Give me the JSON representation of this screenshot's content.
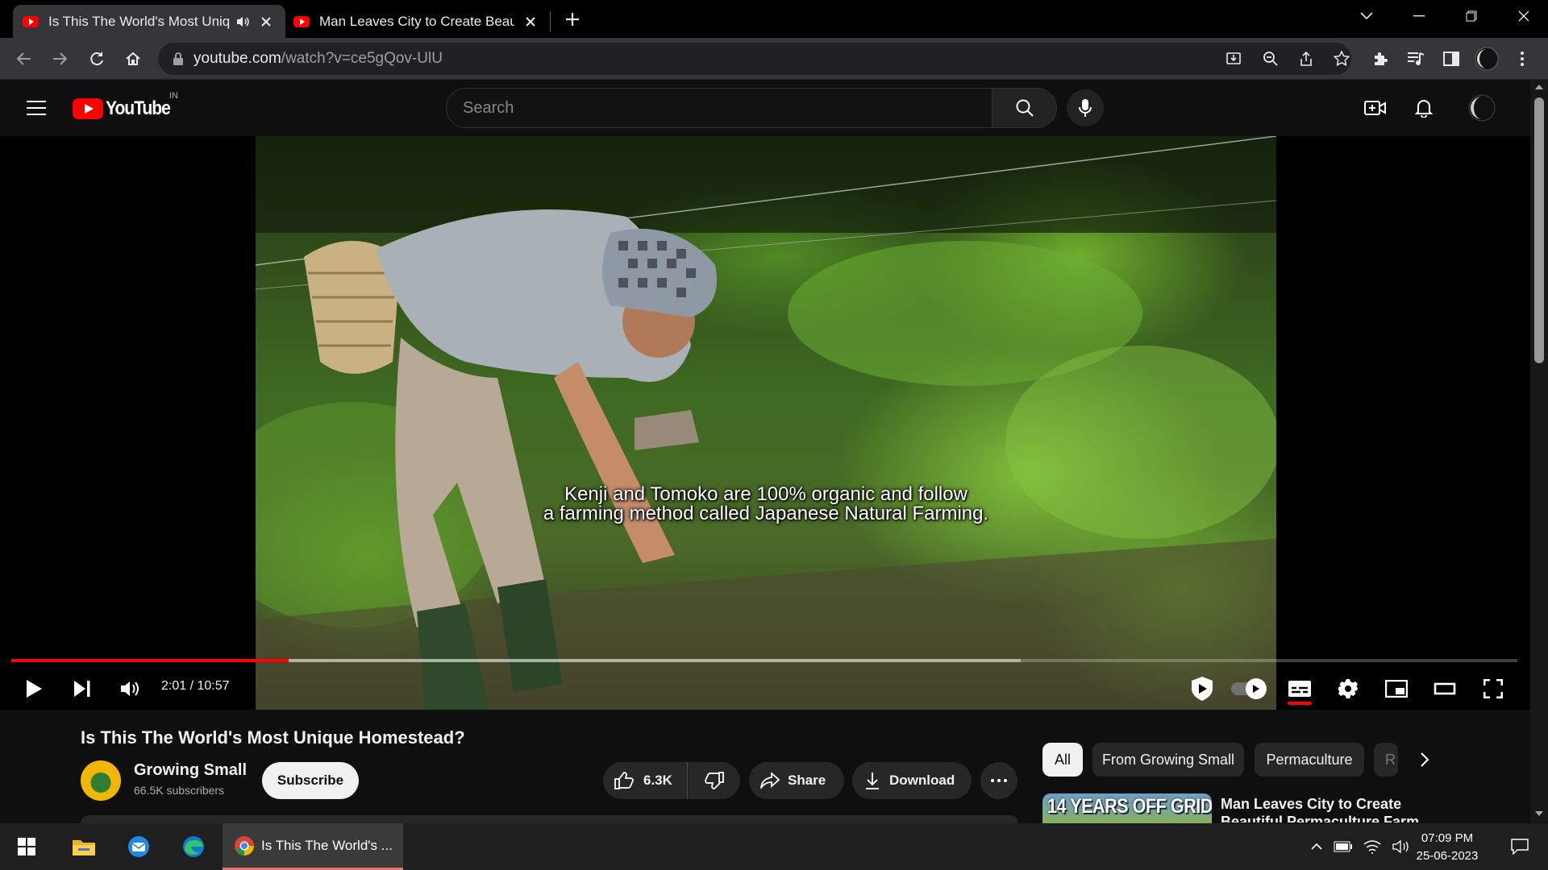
{
  "browser": {
    "tabs": [
      {
        "title": "Is This The World's Most Unique Homestead? - YouTube",
        "active": true,
        "audio": true
      },
      {
        "title": "Man Leaves City to Create Beautiful Permaculture Farm",
        "active": false
      }
    ],
    "address": {
      "host": "youtube.com",
      "path": "/watch?v=ce5gQov-UlU"
    }
  },
  "youtube": {
    "logo_text": "YouTube",
    "country_code": "IN",
    "search_placeholder": "Search"
  },
  "player": {
    "subtitle_lines": [
      "Kenji and Tomoko are 100% organic and follow",
      "a farming method called Japanese Natural Farming."
    ],
    "time_current": "2:01",
    "time_total": "10:57",
    "time_display": "2:01 / 10:57",
    "progress_played_fraction": 0.184,
    "progress_loaded_fraction": 0.67,
    "captions_on": true,
    "autoplay_on": true,
    "accent_color": "#ff0000"
  },
  "video": {
    "title": "Is This The World's Most Unique Homestead?",
    "channel": "Growing Small",
    "subscribers": "66.5K subscribers",
    "subscribe_label": "Subscribe",
    "likes": "6.3K",
    "share_label": "Share",
    "download_label": "Download"
  },
  "chips": [
    "All",
    "From Growing Small",
    "Permaculture",
    "R"
  ],
  "recommendations": [
    {
      "thumb_text": "14 YEARS OFF GRID",
      "title": "Man Leaves City to Create Beautiful Permaculture Farm"
    }
  ],
  "taskbar": {
    "active_app_label": "Is This The World's ...",
    "time": "07:09 PM",
    "date": "25-06-2023"
  },
  "icons": [
    "youtube-favicon",
    "audio-icon",
    "close-icon",
    "new-tab-icon",
    "back-icon",
    "forward-icon",
    "reload-icon",
    "home-icon",
    "lock-icon",
    "install-icon",
    "zoom-icon",
    "share-icon",
    "star-icon",
    "extensions-icon",
    "media-icon",
    "sidepanel-icon",
    "profile-avatar",
    "menu-icon",
    "search-icon",
    "mic-icon",
    "create-icon",
    "bell-icon",
    "play-icon",
    "next-icon",
    "volume-icon",
    "settings-icon",
    "miniplayer-icon",
    "theater-icon",
    "fullscreen-icon",
    "captions-icon",
    "like-icon",
    "dislike-icon",
    "more-icon",
    "chevron-right-icon",
    "windows-start-icon",
    "file-explorer-icon",
    "edge-icon",
    "chrome-icon",
    "notification-icon"
  ]
}
